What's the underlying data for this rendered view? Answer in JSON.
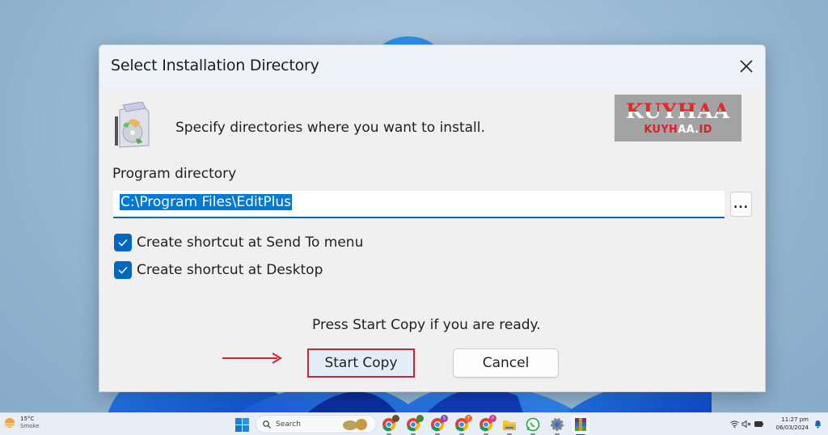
{
  "dialog": {
    "title": "Select Installation Directory",
    "close_icon": "close-icon",
    "header_icon": "software-package-icon",
    "header_text": "Specify directories where you want to install.",
    "logo": {
      "main": "KUYHAA",
      "sub_part1": "KUYH",
      "sub_part2": "AA.",
      "sub_part3": "ID",
      "color_red": "#e5262a",
      "color_bg": "#a3a3a3"
    },
    "program_directory_label": "Program directory",
    "program_directory_value": "C:\\Program Files\\EditPlus",
    "browse_label": "...",
    "checkboxes": [
      {
        "label": "Create shortcut at Send To menu",
        "checked": true
      },
      {
        "label": "Create shortcut at Desktop",
        "checked": true
      }
    ],
    "ready_text": "Press Start Copy if you are ready.",
    "buttons": {
      "start_copy": "Start Copy",
      "cancel": "Cancel"
    },
    "highlight_color": "#d1232a",
    "accent_color": "#0067c0"
  },
  "taskbar": {
    "weather": {
      "temp": "15°C",
      "condition": "Smoke"
    },
    "start_icon": "windows-start-icon",
    "search_placeholder": "Search",
    "apps": [
      {
        "name": "chrome-profile-1",
        "badge": ""
      },
      {
        "name": "chrome-profile-2",
        "badge": ""
      },
      {
        "name": "chrome-profile-3",
        "badge": "S"
      },
      {
        "name": "chrome-profile-4",
        "badge": "T"
      },
      {
        "name": "chrome-profile-5",
        "badge": "P"
      },
      {
        "name": "file-explorer",
        "badge": ""
      },
      {
        "name": "whatsapp",
        "badge": ""
      },
      {
        "name": "settings",
        "badge": ""
      },
      {
        "name": "winrar",
        "badge": ""
      }
    ],
    "tray": {
      "time": "11:27 pm",
      "date": "06/03/2024",
      "icons": [
        "wifi-icon",
        "volume-muted-icon",
        "battery-icon",
        "notification-bell-icon"
      ]
    }
  }
}
